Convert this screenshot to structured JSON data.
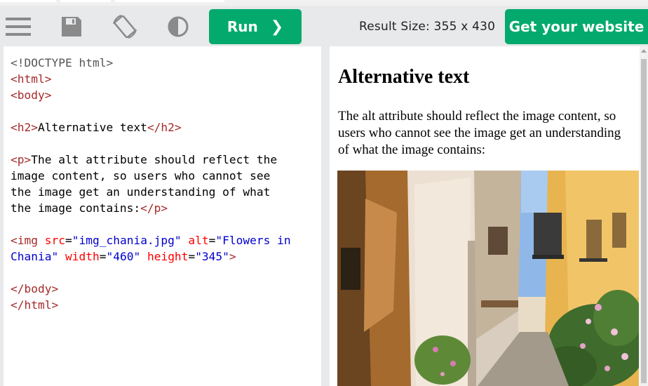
{
  "toolbar": {
    "icons": [
      "menu-icon",
      "save-icon",
      "rotate-icon",
      "contrast-icon"
    ],
    "run_label": "Run",
    "result_size_label": "Result Size: 355 x 430",
    "get_website_label": "Get your website",
    "accent_color": "#04aa6d"
  },
  "editor": {
    "lines": {
      "l1": "<!DOCTYPE html>",
      "l2": "<html>",
      "l3": "<body>",
      "l5_open": "<h2>",
      "l5_text": "Alternative text",
      "l5_close": "</h2>",
      "l7_open": "<p>",
      "l7_text_a": "The alt attribute should reflect the",
      "l7_text_b": "image content, so users who cannot see",
      "l7_text_c": "the image get an understanding of what",
      "l7_text_d": "the image contains:",
      "l7_close": "</p>",
      "l12_tag": "<img",
      "l12_attr1": "src",
      "l12_val1": "\"img_chania.jpg\"",
      "l12_attr2": "alt",
      "l12_val2a": "\"Flowers in",
      "l12_val2b": "Chania\"",
      "l12_attr3": "width",
      "l12_val3": "\"460\"",
      "l12_attr4": "height",
      "l12_val4": "\"345\"",
      "l12_end": ">",
      "l15": "</body>",
      "l16": "</html>"
    }
  },
  "result": {
    "heading": "Alternative text",
    "paragraph": "The alt attribute should reflect the image content, so users who cannot see the image get an understanding of what the image contains:",
    "image_alt": "Flowers in Chania"
  }
}
